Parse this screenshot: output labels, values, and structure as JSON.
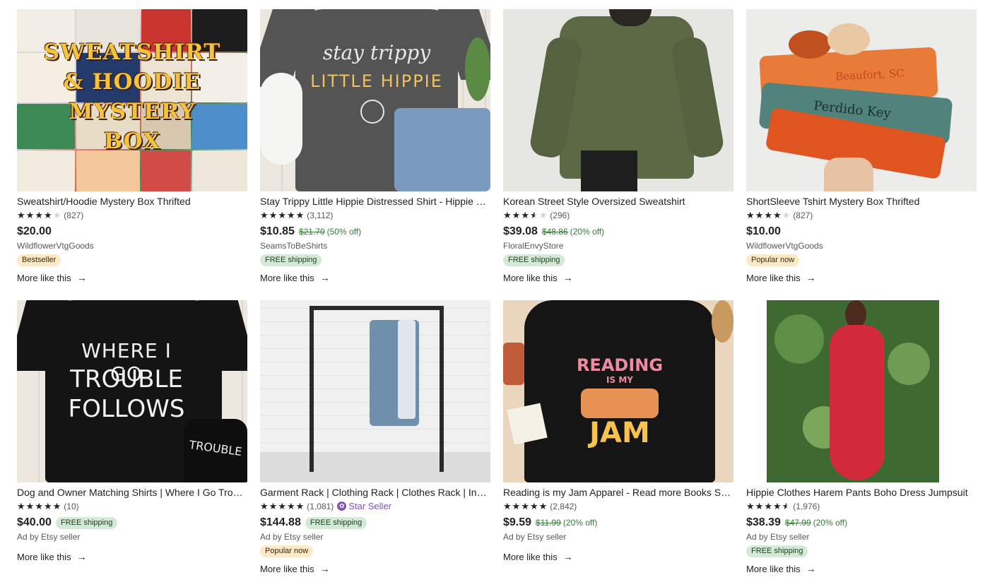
{
  "listings": [
    {
      "title": "Sweatshirt/Hoodie Mystery Box Thrifted",
      "rating": 4,
      "reviews": "(827)",
      "price": "$20.00",
      "shop": "WildflowerVtgGoods",
      "badge": "Bestseller",
      "more": "More like this",
      "image_text": [
        "SWEATSHIRT",
        "& HOODIE",
        "MYSTERY",
        "BOX"
      ]
    },
    {
      "title": "Stay Trippy Little Hippie Distressed Shirt - Hippie Shirt",
      "rating": 5,
      "reviews": "(3,112)",
      "price": "$10.85",
      "orig_price": "$21.70",
      "discount": "(50% off)",
      "shop": "SeamsToBeShirts",
      "badge": "FREE shipping",
      "more": "More like this",
      "image_text": [
        "stay trippy",
        "LITTLE HIPPIE"
      ]
    },
    {
      "title": "Korean Street Style Oversized Sweatshirt",
      "rating": 3.5,
      "reviews": "(296)",
      "price": "$39.08",
      "orig_price": "$48.86",
      "discount": "(20% off)",
      "shop": "FloralEnvyStore",
      "badge": "FREE shipping",
      "more": "More like this"
    },
    {
      "title": "ShortSleeve Tshirt Mystery Box Thrifted",
      "rating": 4,
      "reviews": "(827)",
      "price": "$10.00",
      "shop": "WildflowerVtgGoods",
      "badge": "Popular now",
      "more": "More like this",
      "image_text": [
        "Beaufort, SC",
        "Perdido Key"
      ]
    },
    {
      "title": "Dog and Owner Matching Shirts | Where I Go Trouble Follows",
      "rating": 5,
      "reviews": "(10)",
      "price": "$40.00",
      "price_badge": "FREE shipping",
      "shop": "Ad by Etsy seller",
      "more": "More like this",
      "image_text": [
        "WHERE I GO",
        "TROUBLE",
        "FOLLOWS",
        "TROUBLE"
      ]
    },
    {
      "title": "Garment Rack | Clothing Rack | Clothes Rack | Industrial",
      "rating": 5,
      "reviews": "(1,081)",
      "star_seller": "Star Seller",
      "price": "$144.88",
      "price_badge": "FREE shipping",
      "shop": "Ad by Etsy seller",
      "badge": "Popular now",
      "more": "More like this"
    },
    {
      "title": "Reading is my Jam Apparel - Read more Books Shirt",
      "rating": 5,
      "reviews": "(2,842)",
      "price": "$9.59",
      "orig_price": "$11.99",
      "discount": "(20% off)",
      "shop": "Ad by Etsy seller",
      "more": "More like this",
      "image_text": [
        "READING",
        "IS MY",
        "JAM"
      ]
    },
    {
      "title": "Hippie Clothes Harem Pants Boho Dress Jumpsuit",
      "rating": 4.5,
      "reviews": "(1,976)",
      "price": "$38.39",
      "orig_price": "$47.99",
      "discount": "(20% off)",
      "shop": "Ad by Etsy seller",
      "badge": "FREE shipping",
      "more": "More like this"
    }
  ],
  "icons": {
    "star": "★",
    "arrow": "→",
    "star_seller": "✿"
  },
  "colors": {
    "free_badge_bg": "#d4e9d7",
    "popular_badge_bg": "#fde8c8",
    "discount_green": "#357a38",
    "star_seller_purple": "#7f54b3"
  }
}
